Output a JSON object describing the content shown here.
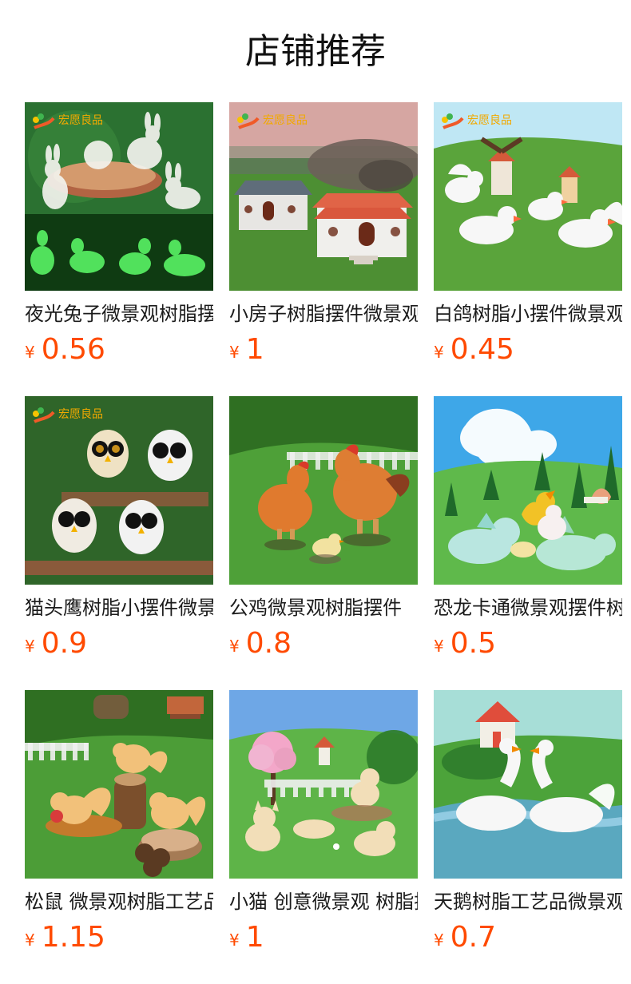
{
  "header": {
    "title": "店铺推荐"
  },
  "products": [
    {
      "name": "夜光兔子微景观树脂摆件",
      "yen": "¥",
      "price": "0.56",
      "icon": "rabbit-thumb"
    },
    {
      "name": "小房子树脂摆件微景观",
      "yen": "¥",
      "price": "1",
      "icon": "house-thumb"
    },
    {
      "name": "白鸽树脂小摆件微景观",
      "yen": "¥",
      "price": "0.45",
      "icon": "dove-thumb"
    },
    {
      "name": "猫头鹰树脂小摆件微景观",
      "yen": "¥",
      "price": "0.9",
      "icon": "owl-thumb"
    },
    {
      "name": "公鸡微景观树脂摆件",
      "yen": "¥",
      "price": "0.8",
      "icon": "rooster-thumb"
    },
    {
      "name": "恐龙卡通微景观摆件树脂",
      "yen": "¥",
      "price": "0.5",
      "icon": "dino-thumb"
    },
    {
      "name": "松鼠 微景观树脂工艺品",
      "yen": "¥",
      "price": "1.15",
      "icon": "squirrel-thumb"
    },
    {
      "name": "小猫 创意微景观 树脂摆件",
      "yen": "¥",
      "price": "1",
      "icon": "cat-thumb"
    },
    {
      "name": "天鹅树脂工艺品微景观摆件",
      "yen": "¥",
      "price": "0.7",
      "icon": "swan-thumb"
    }
  ],
  "colors": {
    "accent": "#ff4a00",
    "title": "#111111",
    "text": "#1b1b1b"
  }
}
